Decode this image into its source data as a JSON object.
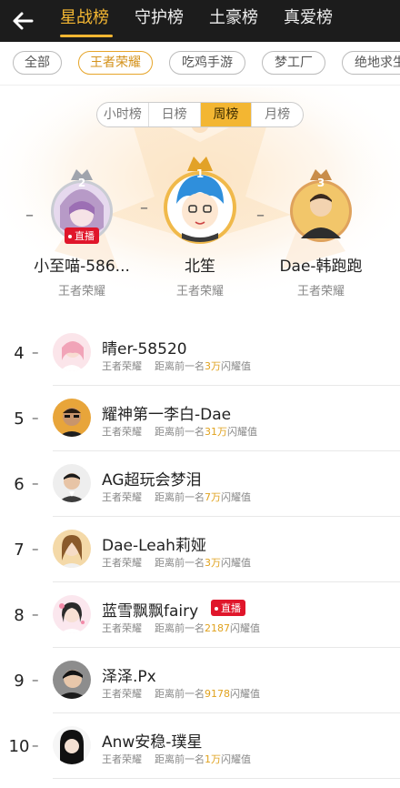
{
  "header": {
    "tabs": [
      {
        "label": "星战榜",
        "active": true
      },
      {
        "label": "守护榜",
        "active": false
      },
      {
        "label": "土豪榜",
        "active": false
      },
      {
        "label": "真爱榜",
        "active": false
      }
    ],
    "accent": "#f3b632",
    "background": "#1c1c1c"
  },
  "categories": [
    {
      "label": "全部",
      "active": false
    },
    {
      "label": "王者荣耀",
      "active": true
    },
    {
      "label": "吃鸡手游",
      "active": false
    },
    {
      "label": "梦工厂",
      "active": false
    },
    {
      "label": "绝地求生",
      "active": false
    }
  ],
  "periods": [
    {
      "label": "小时榜",
      "active": false
    },
    {
      "label": "日榜",
      "active": false
    },
    {
      "label": "周榜",
      "active": true
    },
    {
      "label": "月榜",
      "active": false
    }
  ],
  "podium": [
    {
      "rank": "1",
      "name": "北笙",
      "game": "王者荣耀",
      "trend": "–",
      "live": false
    },
    {
      "rank": "2",
      "name": "小至喵-586...",
      "game": "王者荣耀",
      "trend": "–",
      "live": true,
      "live_label": "直播"
    },
    {
      "rank": "3",
      "name": "Dae-韩跑跑",
      "game": "王者荣耀",
      "trend": "–",
      "live": false
    }
  ],
  "list": [
    {
      "rank": "4",
      "trend": "–",
      "name": "晴er-58520",
      "game": "王者荣耀",
      "gap_prefix": "距离前一名",
      "gap": "3万",
      "gap_suffix": "闪耀值",
      "live": false
    },
    {
      "rank": "5",
      "trend": "–",
      "name": "耀神第一李白-Dae",
      "game": "王者荣耀",
      "gap_prefix": "距离前一名",
      "gap": "31万",
      "gap_suffix": "闪耀值",
      "live": false
    },
    {
      "rank": "6",
      "trend": "–",
      "name": "AG超玩会梦泪",
      "game": "王者荣耀",
      "gap_prefix": "距离前一名",
      "gap": "7万",
      "gap_suffix": "闪耀值",
      "live": false
    },
    {
      "rank": "7",
      "trend": "–",
      "name": "Dae-Leah莉娅",
      "game": "王者荣耀",
      "gap_prefix": "距离前一名",
      "gap": "3万",
      "gap_suffix": "闪耀值",
      "live": false
    },
    {
      "rank": "8",
      "trend": "–",
      "name": "蓝雪飘飘fairy",
      "game": "王者荣耀",
      "gap_prefix": "距离前一名",
      "gap": "2187",
      "gap_suffix": "闪耀值",
      "live": true,
      "live_label": "直播"
    },
    {
      "rank": "9",
      "trend": "–",
      "name": "泽泽.Px",
      "game": "王者荣耀",
      "gap_prefix": "距离前一名",
      "gap": "9178",
      "gap_suffix": "闪耀值",
      "live": false
    },
    {
      "rank": "10",
      "trend": "–",
      "name": "Anw安稳-璞星",
      "game": "王者荣耀",
      "gap_prefix": "距离前一名",
      "gap": "1万",
      "gap_suffix": "闪耀值",
      "live": false
    }
  ]
}
